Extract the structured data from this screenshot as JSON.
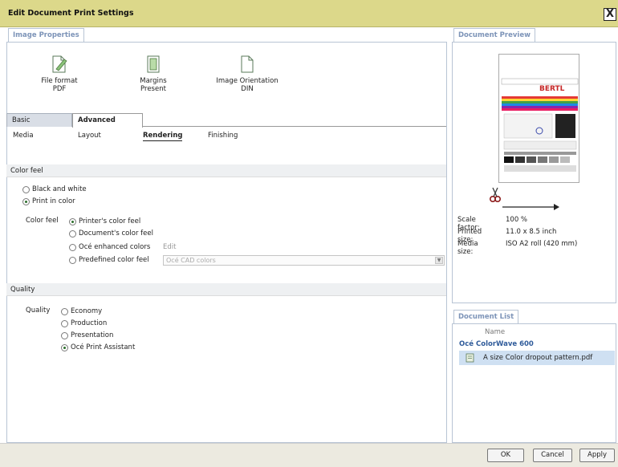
{
  "window": {
    "title": "Edit Document Print Settings",
    "close_label": "X"
  },
  "image_properties": {
    "tab_label": "Image Properties",
    "items": [
      {
        "label": "File format",
        "value": "PDF",
        "icon": "file-format-icon"
      },
      {
        "label": "Margins",
        "value": "Present",
        "icon": "margins-icon"
      },
      {
        "label": "Image Orientation",
        "value": "DIN",
        "icon": "orientation-icon"
      }
    ]
  },
  "tabs": {
    "basic": "Basic",
    "advanced": "Advanced"
  },
  "subtabs": {
    "media": "Media",
    "layout": "Layout",
    "rendering": "Rendering",
    "finishing": "Finishing"
  },
  "color_section": {
    "header": "Color feel",
    "modes": [
      {
        "label": "Black and white",
        "selected": false
      },
      {
        "label": "Print in color",
        "selected": true
      }
    ],
    "feel_label": "Color feel",
    "feels": [
      {
        "label": "Printer's color feel",
        "selected": true
      },
      {
        "label": "Document's color feel",
        "selected": false
      },
      {
        "label": "Océ enhanced colors",
        "selected": false
      },
      {
        "label": "Predefined color feel",
        "selected": false
      }
    ],
    "edit_label": "Edit",
    "predefined_value": "Océ CAD colors"
  },
  "quality_section": {
    "header": "Quality",
    "label": "Quality",
    "options": [
      {
        "label": "Economy",
        "selected": false
      },
      {
        "label": "Production",
        "selected": false
      },
      {
        "label": "Presentation",
        "selected": false
      },
      {
        "label": "Océ Print Assistant",
        "selected": true
      }
    ]
  },
  "preview": {
    "tab_label": "Document Preview",
    "logo_text": "BERTL",
    "scale_label": "Scale factor:",
    "scale_value": "100 %",
    "printed_label": "Printed size:",
    "printed_value": "11.0 x 8.5 inch",
    "media_label": "Media size:",
    "media_value": "ISO A2 roll (420 mm)"
  },
  "doc_list": {
    "tab_label": "Document List",
    "name_header": "Name",
    "printer": "Océ ColorWave 600",
    "file": "A size Color dropout pattern.pdf"
  },
  "buttons": {
    "ok": "OK",
    "cancel": "Cancel",
    "apply": "Apply"
  },
  "colors": {
    "titlebar": "#dcd88a",
    "tab_text": "#7d94b8",
    "link": "#2f5b9a",
    "selection": "#cfe0f2"
  }
}
